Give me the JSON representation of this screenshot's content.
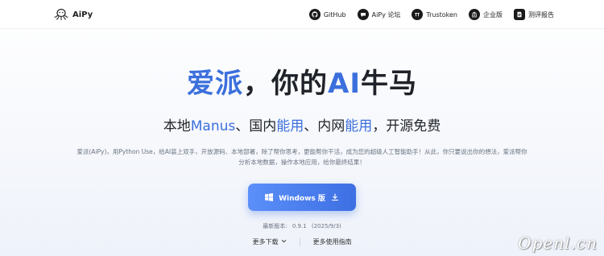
{
  "header": {
    "logo_text": "AiPy",
    "nav": [
      {
        "label": "GitHub",
        "icon": "github-icon"
      },
      {
        "label": "AiPy 论坛",
        "icon": "forum-chat-icon"
      },
      {
        "label": "Trustoken",
        "icon": "trustoken-icon"
      },
      {
        "label": "企业版",
        "icon": "enterprise-building-icon"
      },
      {
        "label": "测评报告",
        "icon": "report-document-icon"
      }
    ]
  },
  "hero": {
    "title_part1": "爱派",
    "title_part2": "，你的",
    "title_part3": "AI",
    "title_part4": "牛马",
    "subtitle_part1": "本地",
    "subtitle_part2": "Manus",
    "subtitle_part3": "、国内",
    "subtitle_part4": "能用",
    "subtitle_part5": "、内网",
    "subtitle_part6": "能用",
    "subtitle_part7": "，开源免费",
    "description": "爱派(AiPy)，用Python Use，给AI装上双手，开放源码、本地部署，除了帮你思考，更能帮你干活，成为您的超级人工智能助手！从此，你只要说出你的想法，爱派帮你分析本地数据，操作本地应用，给你最终结果！"
  },
  "download": {
    "button_label": "Windows 版",
    "version_label": "最新版本:",
    "version_value": "0.9.1",
    "version_date": "(2025/9/3)",
    "more_downloads": "更多下载",
    "more_guide": "更多使用指南"
  },
  "watermark": "Openl.cn",
  "colors": {
    "accent": "#3b6fdc",
    "button_start": "#5b8ff9",
    "button_end": "#3d6fe3"
  }
}
